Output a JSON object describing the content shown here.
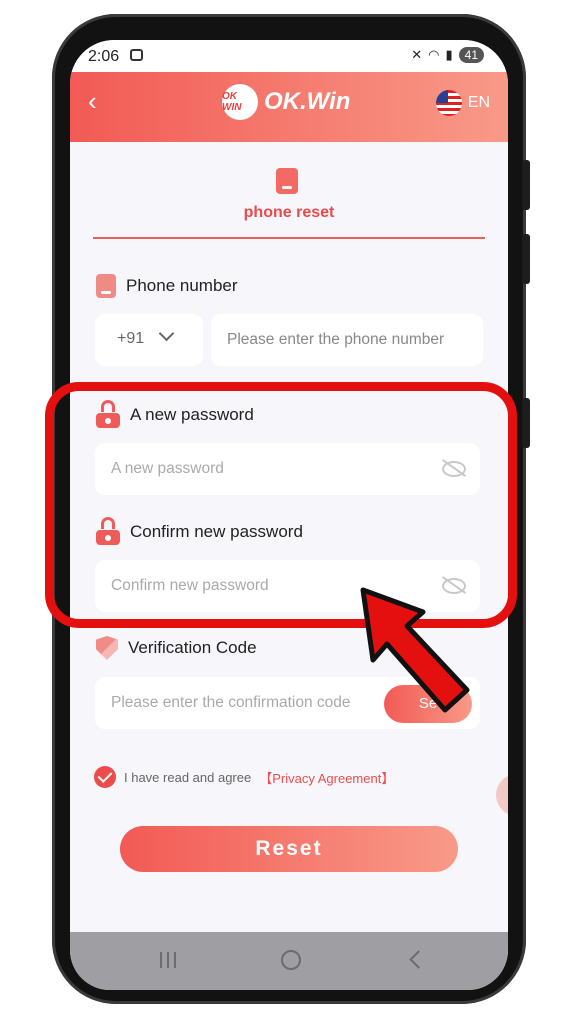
{
  "status_bar": {
    "time": "2:06",
    "battery": "41"
  },
  "header": {
    "logo_badge": "OK WIN",
    "logo_text": "OK.Win",
    "language": "EN"
  },
  "tab": {
    "title": "phone reset"
  },
  "phone": {
    "label": "Phone number",
    "country_code": "+91",
    "placeholder": "Please enter the phone number"
  },
  "new_password": {
    "label": "A new password",
    "placeholder": "A new password"
  },
  "confirm_password": {
    "label": "Confirm new password",
    "placeholder": "Confirm new password"
  },
  "verification": {
    "label": "Verification Code",
    "placeholder": "Please enter the confirmation code",
    "send_label": "Se"
  },
  "agreement": {
    "text": "I have read and agree",
    "link": "【Privacy Agreement】",
    "checked": true
  },
  "reset_button": "Reset",
  "colors": {
    "accent": "#ee4c4c",
    "gradient_start": "#f25a55",
    "gradient_end": "#f89a88",
    "highlight": "#e41010"
  },
  "icons": [
    "back-icon",
    "flag-us-icon",
    "phone-icon",
    "lock-icon",
    "shield-icon",
    "eye-off-icon",
    "chevron-down-icon",
    "check-icon",
    "arrow-pointer"
  ]
}
